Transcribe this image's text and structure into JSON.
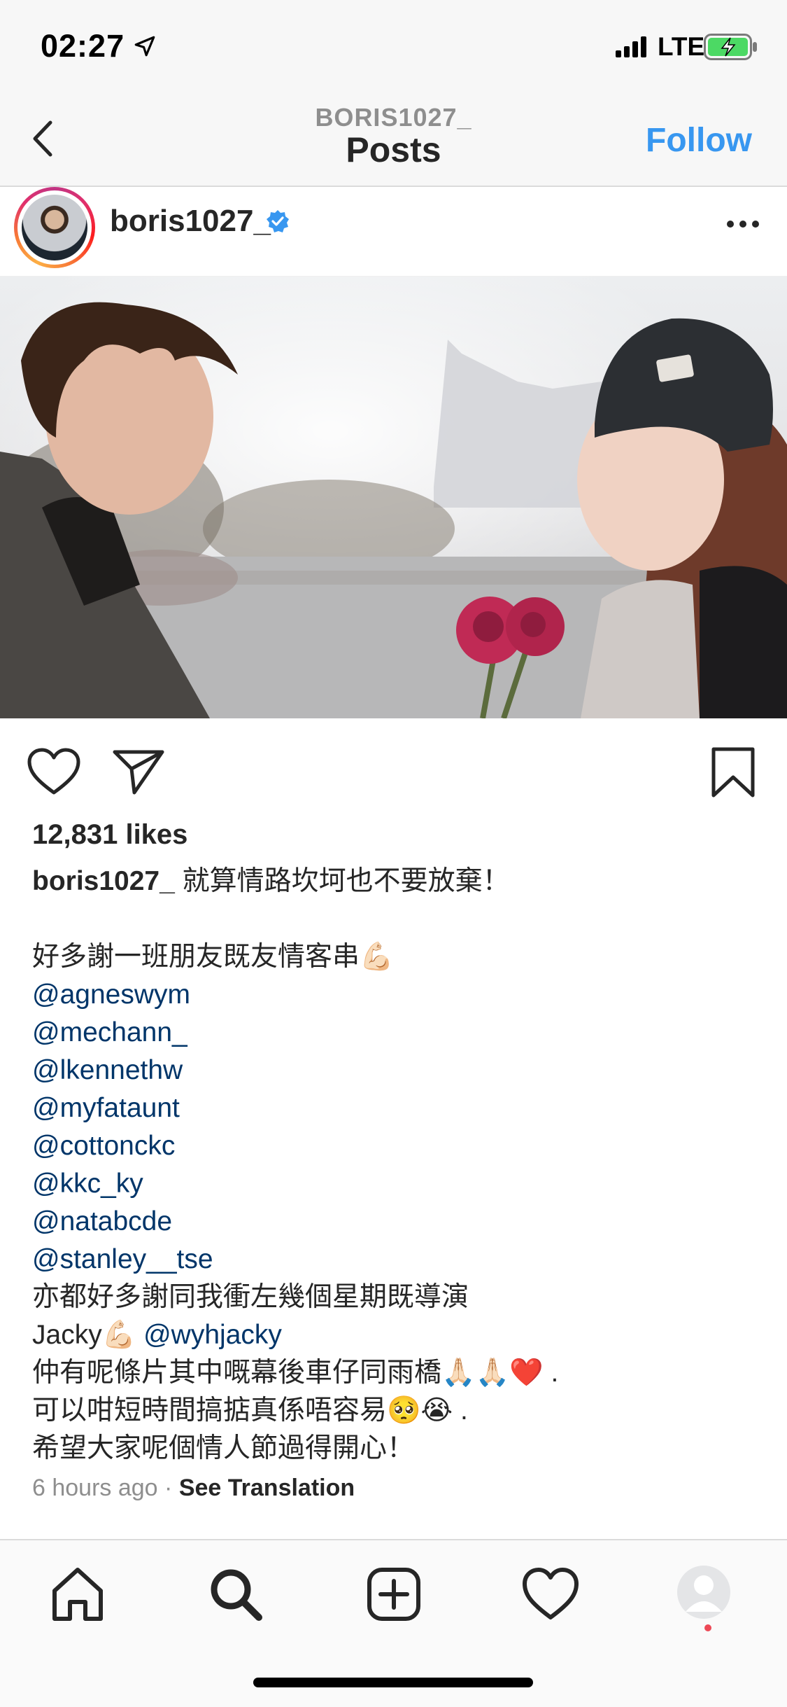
{
  "status_bar": {
    "time": "02:27",
    "network": "LTE"
  },
  "nav": {
    "subtitle": "BORIS1027_",
    "title": "Posts",
    "follow_label": "Follow"
  },
  "post": {
    "username": "boris1027_",
    "likes": "12,831 likes",
    "caption": {
      "user": "boris1027_",
      "first_line": "就算情路坎坷也不要放棄！",
      "lines": [
        "好多謝一班朋友既友情客串💪🏻"
      ],
      "mentions": [
        "@agneswym",
        "@mechann_",
        "@lkennethw",
        "@myfataunt",
        "@cottonckc",
        "@kkc_ky",
        "@natabcde",
        "@stanley__tse"
      ],
      "director_line": "亦都好多謝同我衝左幾個星期既導演",
      "director_name": "Jacky💪🏻 ",
      "director_mention": "@wyhjacky",
      "closing": [
        "仲有呢條片其中嘅幕後車仔同雨橋🙏🏻🙏🏻❤️ .",
        "可以咁短時間搞掂真係唔容易🥺😭 .",
        "希望大家呢個情人節過得開心！"
      ]
    },
    "timestamp": "6 hours ago",
    "separator": "·",
    "see_translation": "See Translation"
  },
  "icons": {
    "back": "chevron-left-icon",
    "verified": "verified-badge-icon",
    "more": "more-horizontal-icon",
    "like": "heart-icon",
    "share": "send-icon",
    "save": "bookmark-icon",
    "tabs": [
      "home-icon",
      "search-icon",
      "add-post-icon",
      "activity-heart-icon",
      "profile-avatar-icon"
    ]
  },
  "colors": {
    "accent": "#3897f0",
    "mention": "#003569",
    "text": "#262626",
    "muted": "#8e8e8e"
  }
}
